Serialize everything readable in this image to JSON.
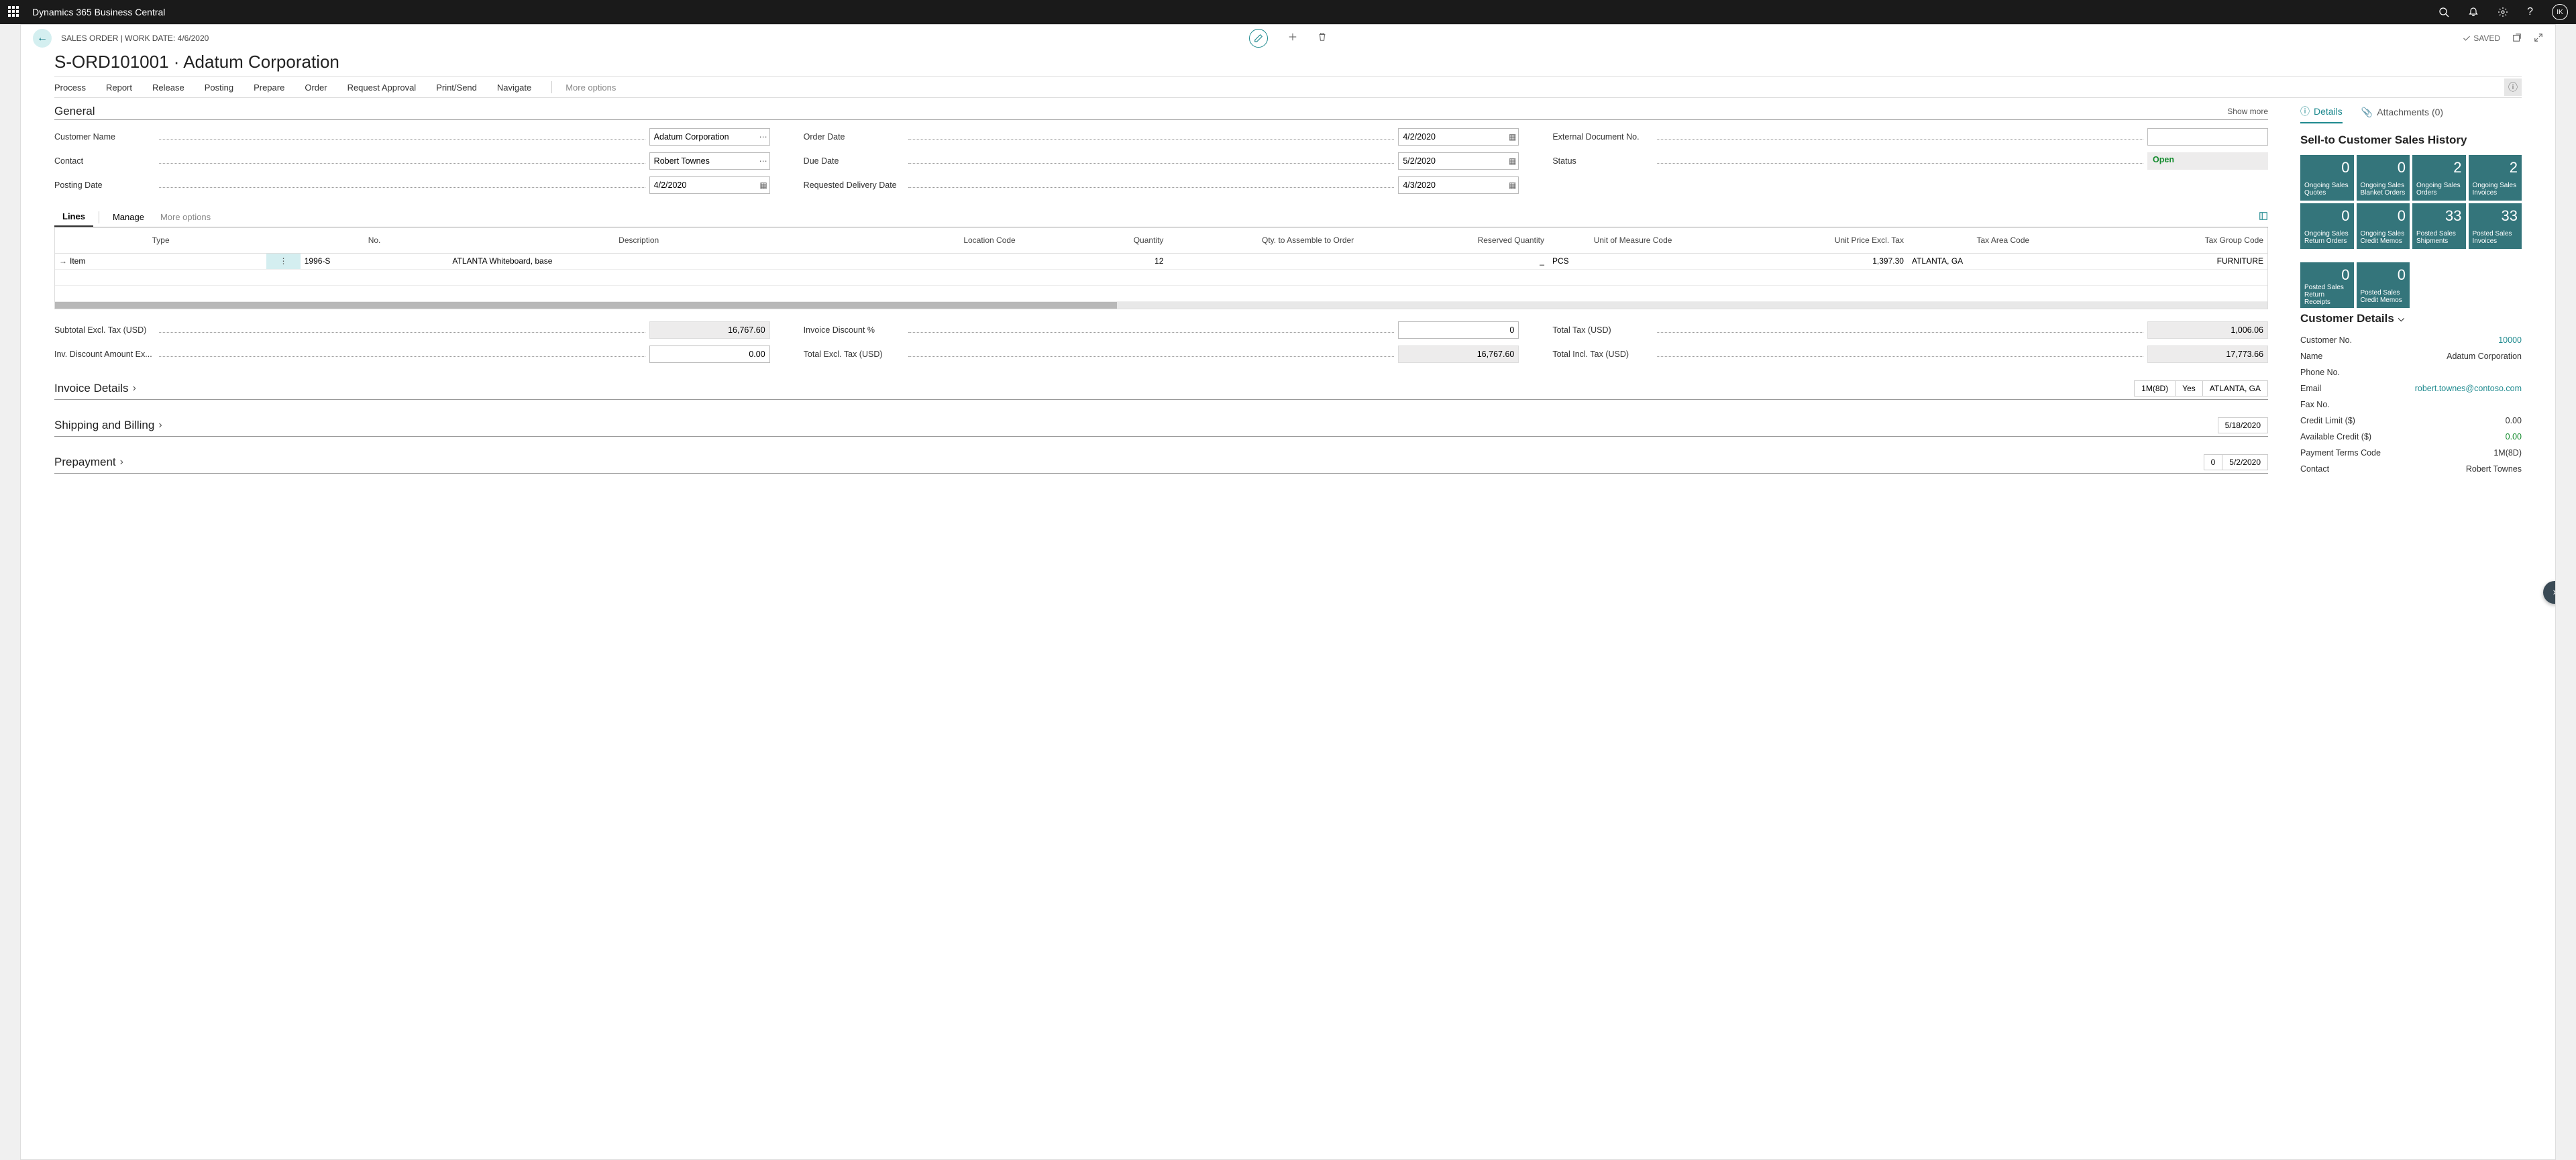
{
  "app_name": "Dynamics 365 Business Central",
  "top_icons": {
    "avatar": "IK"
  },
  "breadcrumb": "SALES ORDER | WORK DATE: 4/6/2020",
  "saved_label": "SAVED",
  "page_title": "S-ORD101001 · Adatum Corporation",
  "actions": [
    "Process",
    "Report",
    "Release",
    "Posting",
    "Prepare",
    "Order",
    "Request Approval",
    "Print/Send",
    "Navigate"
  ],
  "more_options": "More options",
  "general": {
    "heading": "General",
    "show_more": "Show more",
    "fields": {
      "customer_name": {
        "label": "Customer Name",
        "value": "Adatum Corporation"
      },
      "contact": {
        "label": "Contact",
        "value": "Robert Townes"
      },
      "posting_date": {
        "label": "Posting Date",
        "value": "4/2/2020"
      },
      "order_date": {
        "label": "Order Date",
        "value": "4/2/2020"
      },
      "due_date": {
        "label": "Due Date",
        "value": "5/2/2020"
      },
      "req_delivery": {
        "label": "Requested Delivery Date",
        "value": "4/3/2020"
      },
      "ext_doc": {
        "label": "External Document No.",
        "value": ""
      },
      "status": {
        "label": "Status",
        "value": "Open"
      }
    }
  },
  "lines": {
    "tab_lines": "Lines",
    "tab_manage": "Manage",
    "more": "More options",
    "columns": [
      "Type",
      "No.",
      "Description",
      "Location Code",
      "Quantity",
      "Qty. to Assemble to Order",
      "Reserved Quantity",
      "Unit of Measure Code",
      "Unit Price Excl. Tax",
      "Tax Area Code",
      "Tax Group Code"
    ],
    "row": {
      "type": "Item",
      "no": "1996-S",
      "desc": "ATLANTA Whiteboard, base",
      "loc": "",
      "qty": "12",
      "qty_asm": "",
      "reserved": "_",
      "uom": "PCS",
      "price": "1,397.30",
      "tax_area": "ATLANTA, GA",
      "tax_group": "FURNITURE"
    }
  },
  "totals": {
    "subtotal": {
      "label": "Subtotal Excl. Tax (USD)",
      "value": "16,767.60"
    },
    "inv_disc_amt": {
      "label": "Inv. Discount Amount Ex...",
      "value": "0.00"
    },
    "inv_disc_pct": {
      "label": "Invoice Discount %",
      "value": "0"
    },
    "total_excl": {
      "label": "Total Excl. Tax (USD)",
      "value": "16,767.60"
    },
    "total_tax": {
      "label": "Total Tax (USD)",
      "value": "1,006.06"
    },
    "total_incl": {
      "label": "Total Incl. Tax (USD)",
      "value": "17,773.66"
    }
  },
  "sections": {
    "invoice_details": {
      "title": "Invoice Details",
      "summary": [
        "1M(8D)",
        "Yes",
        "ATLANTA, GA"
      ]
    },
    "shipping": {
      "title": "Shipping and Billing",
      "summary": [
        "5/18/2020"
      ]
    },
    "prepayment": {
      "title": "Prepayment",
      "summary": [
        "0",
        "5/2/2020"
      ]
    }
  },
  "side": {
    "tab_details": "Details",
    "tab_attach": "Attachments (0)",
    "history_title": "Sell-to Customer Sales History",
    "tiles": [
      {
        "num": "0",
        "lbl": "Ongoing Sales Quotes"
      },
      {
        "num": "0",
        "lbl": "Ongoing Sales Blanket Orders"
      },
      {
        "num": "2",
        "lbl": "Ongoing Sales Orders"
      },
      {
        "num": "2",
        "lbl": "Ongoing Sales Invoices"
      },
      {
        "num": "0",
        "lbl": "Ongoing Sales Return Orders"
      },
      {
        "num": "0",
        "lbl": "Ongoing Sales Credit Memos"
      },
      {
        "num": "33",
        "lbl": "Posted Sales Shipments"
      },
      {
        "num": "33",
        "lbl": "Posted Sales Invoices"
      },
      {
        "num": "0",
        "lbl": "Posted Sales Return Receipts"
      },
      {
        "num": "0",
        "lbl": "Posted Sales Credit Memos"
      }
    ],
    "cust_details_title": "Customer Details",
    "details": [
      {
        "lbl": "Customer No.",
        "val": "10000",
        "link": true
      },
      {
        "lbl": "Name",
        "val": "Adatum Corporation"
      },
      {
        "lbl": "Phone No.",
        "val": ""
      },
      {
        "lbl": "Email",
        "val": "robert.townes@contoso.com",
        "link": true
      },
      {
        "lbl": "Fax No.",
        "val": ""
      },
      {
        "lbl": "Credit Limit ($)",
        "val": "0.00"
      },
      {
        "lbl": "Available Credit ($)",
        "val": "0.00",
        "green": true
      },
      {
        "lbl": "Payment Terms Code",
        "val": "1M(8D)"
      },
      {
        "lbl": "Contact",
        "val": "Robert Townes"
      }
    ]
  }
}
